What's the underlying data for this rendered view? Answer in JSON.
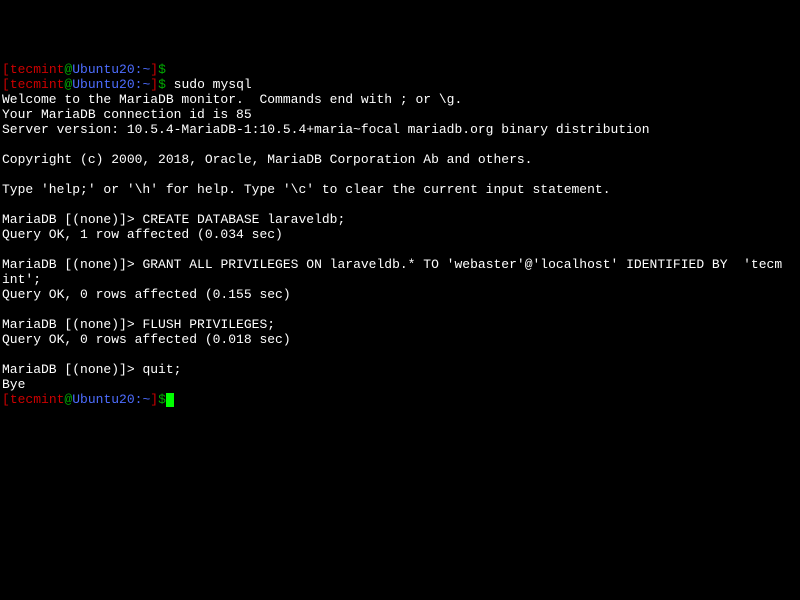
{
  "prompt1": {
    "open_bracket": "[",
    "user": "tecmint",
    "at": "@",
    "host_path": "Ubuntu20:~",
    "close_bracket": "]",
    "dollar": "$"
  },
  "prompt2_cmd": " sudo mysql",
  "welcome": "Welcome to the MariaDB monitor.  Commands end with ; or \\g.",
  "conn_id": "Your MariaDB connection id is 85",
  "server_version": "Server version: 10.5.4-MariaDB-1:10.5.4+maria~focal mariadb.org binary distribution",
  "copyright": "Copyright (c) 2000, 2018, Oracle, MariaDB Corporation Ab and others.",
  "help": "Type 'help;' or '\\h' for help. Type '\\c' to clear the current input statement.",
  "db_prompt": "MariaDB [(none)]> ",
  "create_db": "CREATE DATABASE laraveldb;",
  "query_ok1": "Query OK, 1 row affected (0.034 sec)",
  "grant": "GRANT ALL PRIVILEGES ON laraveldb.* TO 'webaster'@'localhost' IDENTIFIED BY  'tecm",
  "grant2": "int';",
  "query_ok2": "Query OK, 0 rows affected (0.155 sec)",
  "flush": "FLUSH PRIVILEGES;",
  "query_ok3": "Query OK, 0 rows affected (0.018 sec)",
  "quit": "quit;",
  "bye": "Bye"
}
